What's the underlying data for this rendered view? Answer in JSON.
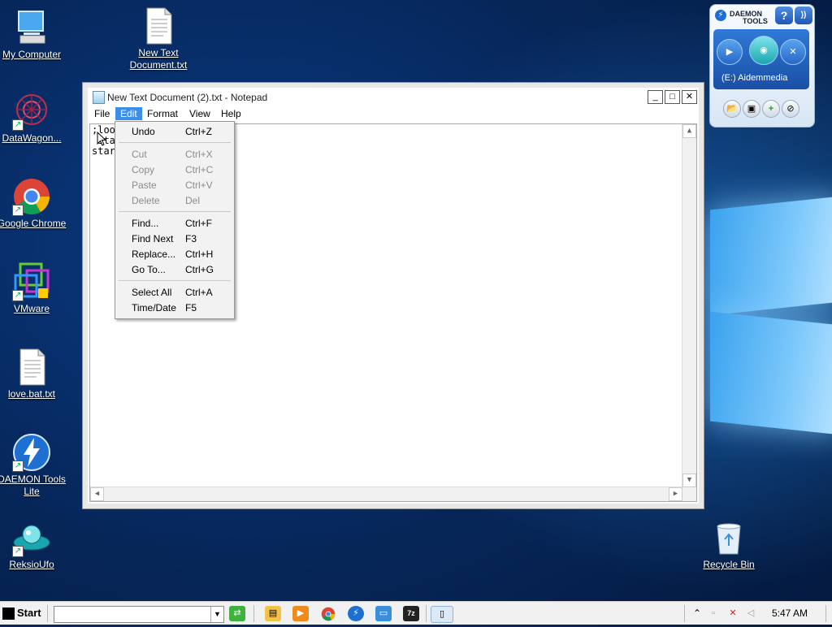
{
  "desktop": {
    "icons": [
      {
        "label": "My Computer"
      },
      {
        "label": "DataWagon..."
      },
      {
        "label": "Google Chrome"
      },
      {
        "label": "VMware"
      },
      {
        "label": "love.bat.txt"
      },
      {
        "label": "DAEMON Tools Lite"
      },
      {
        "label": "ReksioUfo"
      },
      {
        "label": "New Text Document.txt"
      },
      {
        "label": "Recycle Bin"
      }
    ]
  },
  "notepad": {
    "title": "New Text Document (2).txt - Notepad",
    "minimize_glyph": "_",
    "maximize_glyph": "□",
    "close_glyph": "✕",
    "menu": {
      "file": "File",
      "edit": "Edit",
      "format": "Format",
      "view": "View",
      "help": "Help"
    },
    "content": ";loo\n sta\nstar"
  },
  "edit_menu": {
    "items": [
      {
        "label": "Undo",
        "shortcut": "Ctrl+Z",
        "enabled": true
      },
      {
        "label": "Cut",
        "shortcut": "Ctrl+X",
        "enabled": false
      },
      {
        "label": "Copy",
        "shortcut": "Ctrl+C",
        "enabled": false
      },
      {
        "label": "Paste",
        "shortcut": "Ctrl+V",
        "enabled": false
      },
      {
        "label": "Delete",
        "shortcut": "Del",
        "enabled": false
      },
      {
        "label": "Find...",
        "shortcut": "Ctrl+F",
        "enabled": true
      },
      {
        "label": "Find Next",
        "shortcut": "F3",
        "enabled": true
      },
      {
        "label": "Replace...",
        "shortcut": "Ctrl+H",
        "enabled": true
      },
      {
        "label": "Go To...",
        "shortcut": "Ctrl+G",
        "enabled": true
      },
      {
        "label": "Select All",
        "shortcut": "Ctrl+A",
        "enabled": true
      },
      {
        "label": "Time/Date",
        "shortcut": "F5",
        "enabled": true
      }
    ]
  },
  "daemon_widget": {
    "brand_line1": "DAEMON",
    "brand_line2": "TOOLS",
    "drive_label": "(E:) Aidemmedia",
    "help_glyph": "?",
    "feed_glyph": "))"
  },
  "taskbar": {
    "start_label": "Start",
    "clock": "5:47 AM"
  },
  "colors": {
    "menu_highlight": "#3d8ee6",
    "wallpaper_dark": "#062659",
    "wallpaper_light": "#7cc8fb"
  }
}
